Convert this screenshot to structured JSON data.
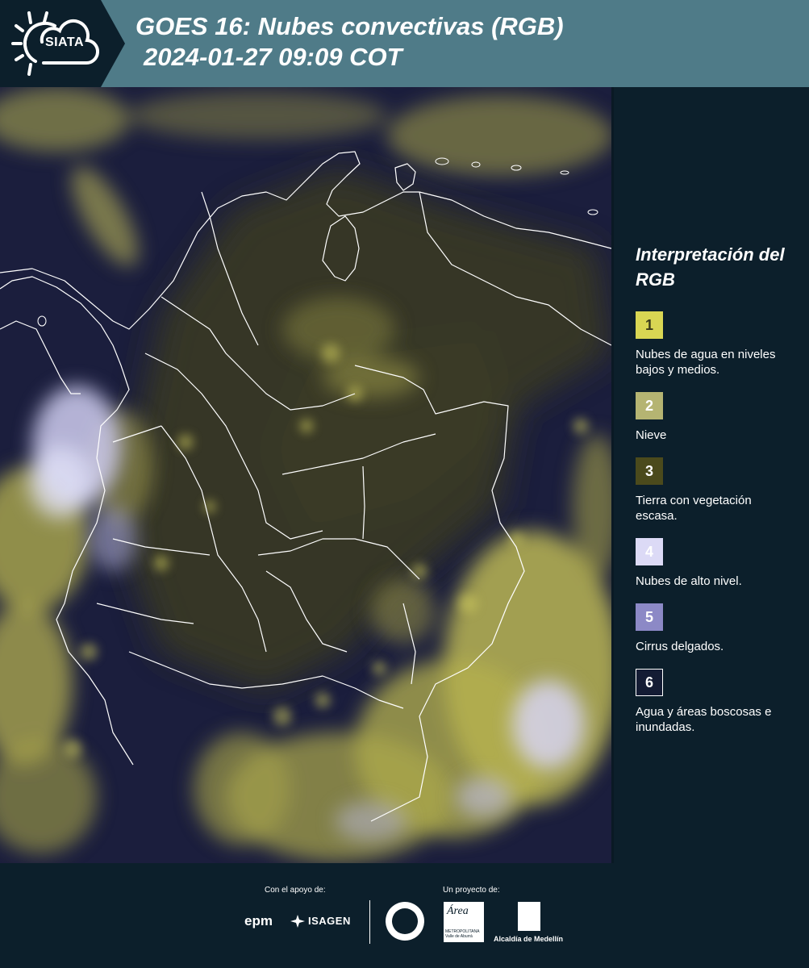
{
  "header": {
    "logo_text": "SIATA",
    "title_line1": "GOES 16: Nubes convectivas (RGB)",
    "title_line2": "2024-01-27 09:09 COT",
    "background_color": "#4f7b88"
  },
  "map": {
    "product": "GOES 16 RGB convective clouds satellite imagery",
    "region": "Colombia",
    "border_color": "#ffffff"
  },
  "legend": {
    "title": "Interpretación del RGB",
    "items": [
      {
        "number": "1",
        "label": "Nubes de agua en niveles bajos y medios.",
        "color": "#d9d653",
        "text_color": "#3a3a1a"
      },
      {
        "number": "2",
        "label": "Nieve",
        "color": "#b5b472",
        "text_color": "#ffffff"
      },
      {
        "number": "3",
        "label": "Tierra con vegetación escasa.",
        "color": "#4b4a1c",
        "text_color": "#ffffff"
      },
      {
        "number": "4",
        "label": "Nubes de alto nivel.",
        "color": "#dcdaf6",
        "text_color": "#ffffff"
      },
      {
        "number": "5",
        "label": "Cirrus delgados.",
        "color": "#8c89c6",
        "text_color": "#ffffff"
      },
      {
        "number": "6",
        "label": "Agua y áreas boscosas e inundadas.",
        "color": "#141c34",
        "text_color": "#ffffff"
      }
    ]
  },
  "footer": {
    "support_label": "Con el apoyo de:",
    "project_label": "Un proyecto de:",
    "sponsors": [
      "epm",
      "ISAGEN"
    ],
    "partners": {
      "area_logo_text": "Área",
      "area_sub": "METROPOLITANA Valle de Aburrá",
      "alcaldia": "Alcaldía de Medellín"
    }
  }
}
